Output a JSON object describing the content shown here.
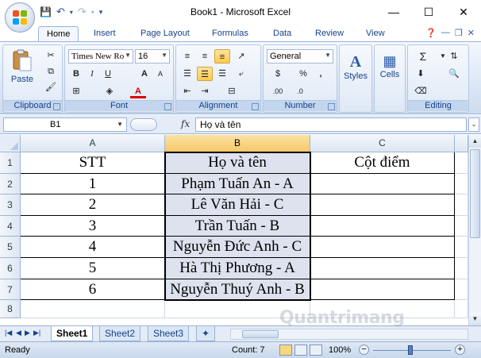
{
  "window": {
    "title": "Book1 - Microsoft Excel",
    "minimize_glyph": "—",
    "maximize_glyph": "☐",
    "close_glyph": "✕"
  },
  "qat": {
    "save": "💾",
    "undo": "↶",
    "redo": "↷",
    "customize": "▾"
  },
  "tabs": [
    "Home",
    "Insert",
    "Page Layout",
    "Formulas",
    "Data",
    "Review",
    "View"
  ],
  "ribbon": {
    "clipboard": {
      "label": "Clipboard",
      "paste": "Paste"
    },
    "font": {
      "label": "Font",
      "font_name": "Times New Ro",
      "font_size": "16",
      "bold": "B",
      "italic": "I",
      "underline": "U",
      "grow": "A",
      "shrink": "A"
    },
    "alignment": {
      "label": "Alignment"
    },
    "number": {
      "label": "Number",
      "format": "General",
      "currency": "$",
      "percent": "%",
      "comma": ",",
      "inc_dec": ".00",
      "dec_dec": ".0"
    },
    "styles": {
      "label": "Styles"
    },
    "cells": {
      "label": "Cells"
    },
    "editing": {
      "label": "Editing",
      "sum": "Σ"
    }
  },
  "formula_bar": {
    "name_box": "B1",
    "fx": "fx",
    "value": "Họ và tên"
  },
  "columns": [
    "A",
    "B",
    "C"
  ],
  "rows": [
    {
      "num": "1",
      "a": "STT",
      "b": "Họ và tên",
      "c": "Cột điểm"
    },
    {
      "num": "2",
      "a": "1",
      "b": "Phạm Tuấn An - A",
      "c": ""
    },
    {
      "num": "3",
      "a": "2",
      "b": "Lê Văn Hải - C",
      "c": ""
    },
    {
      "num": "4",
      "a": "3",
      "b": "Trần Tuấn - B",
      "c": ""
    },
    {
      "num": "5",
      "a": "4",
      "b": "Nguyễn Đức Anh - C",
      "c": ""
    },
    {
      "num": "6",
      "a": "5",
      "b": "Hà Thị Phương - A",
      "c": ""
    },
    {
      "num": "7",
      "a": "6",
      "b": "Nguyễn Thuý Anh - B",
      "c": ""
    },
    {
      "num": "8",
      "a": "",
      "b": "",
      "c": ""
    }
  ],
  "sheets": [
    "Sheet1",
    "Sheet2",
    "Sheet3"
  ],
  "status": {
    "ready": "Ready",
    "count": "Count: 7",
    "zoom": "100%",
    "minus": "−",
    "plus": "+"
  },
  "watermark": "Quantrimang",
  "colors": {
    "selected_header": "#f7c86a",
    "selection_fill": "#dde2ee",
    "ribbon": "#dbe7f6"
  }
}
